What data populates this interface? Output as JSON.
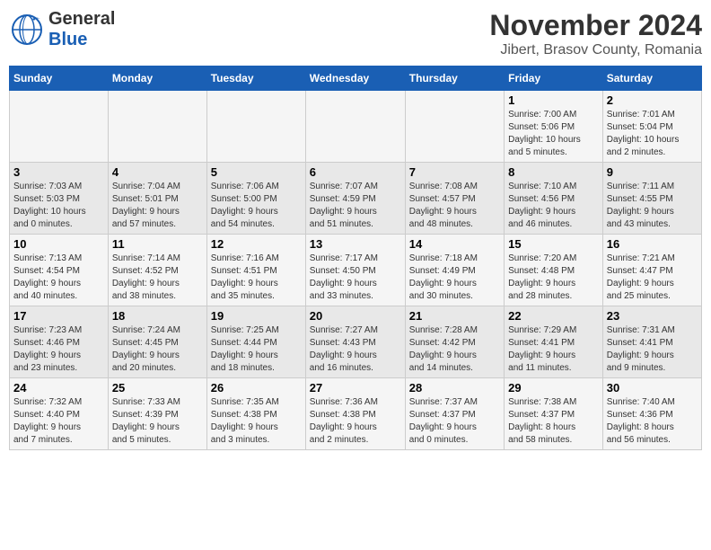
{
  "logo": {
    "general": "General",
    "blue": "Blue"
  },
  "title": "November 2024",
  "subtitle": "Jibert, Brasov County, Romania",
  "days_of_week": [
    "Sunday",
    "Monday",
    "Tuesday",
    "Wednesday",
    "Thursday",
    "Friday",
    "Saturday"
  ],
  "weeks": [
    [
      {
        "day": "",
        "info": ""
      },
      {
        "day": "",
        "info": ""
      },
      {
        "day": "",
        "info": ""
      },
      {
        "day": "",
        "info": ""
      },
      {
        "day": "",
        "info": ""
      },
      {
        "day": "1",
        "info": "Sunrise: 7:00 AM\nSunset: 5:06 PM\nDaylight: 10 hours\nand 5 minutes."
      },
      {
        "day": "2",
        "info": "Sunrise: 7:01 AM\nSunset: 5:04 PM\nDaylight: 10 hours\nand 2 minutes."
      }
    ],
    [
      {
        "day": "3",
        "info": "Sunrise: 7:03 AM\nSunset: 5:03 PM\nDaylight: 10 hours\nand 0 minutes."
      },
      {
        "day": "4",
        "info": "Sunrise: 7:04 AM\nSunset: 5:01 PM\nDaylight: 9 hours\nand 57 minutes."
      },
      {
        "day": "5",
        "info": "Sunrise: 7:06 AM\nSunset: 5:00 PM\nDaylight: 9 hours\nand 54 minutes."
      },
      {
        "day": "6",
        "info": "Sunrise: 7:07 AM\nSunset: 4:59 PM\nDaylight: 9 hours\nand 51 minutes."
      },
      {
        "day": "7",
        "info": "Sunrise: 7:08 AM\nSunset: 4:57 PM\nDaylight: 9 hours\nand 48 minutes."
      },
      {
        "day": "8",
        "info": "Sunrise: 7:10 AM\nSunset: 4:56 PM\nDaylight: 9 hours\nand 46 minutes."
      },
      {
        "day": "9",
        "info": "Sunrise: 7:11 AM\nSunset: 4:55 PM\nDaylight: 9 hours\nand 43 minutes."
      }
    ],
    [
      {
        "day": "10",
        "info": "Sunrise: 7:13 AM\nSunset: 4:54 PM\nDaylight: 9 hours\nand 40 minutes."
      },
      {
        "day": "11",
        "info": "Sunrise: 7:14 AM\nSunset: 4:52 PM\nDaylight: 9 hours\nand 38 minutes."
      },
      {
        "day": "12",
        "info": "Sunrise: 7:16 AM\nSunset: 4:51 PM\nDaylight: 9 hours\nand 35 minutes."
      },
      {
        "day": "13",
        "info": "Sunrise: 7:17 AM\nSunset: 4:50 PM\nDaylight: 9 hours\nand 33 minutes."
      },
      {
        "day": "14",
        "info": "Sunrise: 7:18 AM\nSunset: 4:49 PM\nDaylight: 9 hours\nand 30 minutes."
      },
      {
        "day": "15",
        "info": "Sunrise: 7:20 AM\nSunset: 4:48 PM\nDaylight: 9 hours\nand 28 minutes."
      },
      {
        "day": "16",
        "info": "Sunrise: 7:21 AM\nSunset: 4:47 PM\nDaylight: 9 hours\nand 25 minutes."
      }
    ],
    [
      {
        "day": "17",
        "info": "Sunrise: 7:23 AM\nSunset: 4:46 PM\nDaylight: 9 hours\nand 23 minutes."
      },
      {
        "day": "18",
        "info": "Sunrise: 7:24 AM\nSunset: 4:45 PM\nDaylight: 9 hours\nand 20 minutes."
      },
      {
        "day": "19",
        "info": "Sunrise: 7:25 AM\nSunset: 4:44 PM\nDaylight: 9 hours\nand 18 minutes."
      },
      {
        "day": "20",
        "info": "Sunrise: 7:27 AM\nSunset: 4:43 PM\nDaylight: 9 hours\nand 16 minutes."
      },
      {
        "day": "21",
        "info": "Sunrise: 7:28 AM\nSunset: 4:42 PM\nDaylight: 9 hours\nand 14 minutes."
      },
      {
        "day": "22",
        "info": "Sunrise: 7:29 AM\nSunset: 4:41 PM\nDaylight: 9 hours\nand 11 minutes."
      },
      {
        "day": "23",
        "info": "Sunrise: 7:31 AM\nSunset: 4:41 PM\nDaylight: 9 hours\nand 9 minutes."
      }
    ],
    [
      {
        "day": "24",
        "info": "Sunrise: 7:32 AM\nSunset: 4:40 PM\nDaylight: 9 hours\nand 7 minutes."
      },
      {
        "day": "25",
        "info": "Sunrise: 7:33 AM\nSunset: 4:39 PM\nDaylight: 9 hours\nand 5 minutes."
      },
      {
        "day": "26",
        "info": "Sunrise: 7:35 AM\nSunset: 4:38 PM\nDaylight: 9 hours\nand 3 minutes."
      },
      {
        "day": "27",
        "info": "Sunrise: 7:36 AM\nSunset: 4:38 PM\nDaylight: 9 hours\nand 2 minutes."
      },
      {
        "day": "28",
        "info": "Sunrise: 7:37 AM\nSunset: 4:37 PM\nDaylight: 9 hours\nand 0 minutes."
      },
      {
        "day": "29",
        "info": "Sunrise: 7:38 AM\nSunset: 4:37 PM\nDaylight: 8 hours\nand 58 minutes."
      },
      {
        "day": "30",
        "info": "Sunrise: 7:40 AM\nSunset: 4:36 PM\nDaylight: 8 hours\nand 56 minutes."
      }
    ]
  ]
}
